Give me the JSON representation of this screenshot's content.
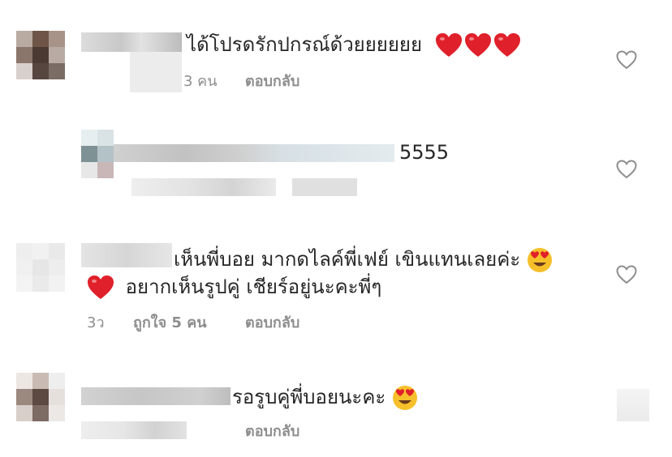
{
  "comments": [
    {
      "text": "ได้โปรดรักปกรณ์ด้วยยยยยย",
      "likes_meta": "3 คน",
      "reply_label": "ตอบกลับ",
      "trailing_emoji": [
        "red-heart",
        "red-heart",
        "red-heart"
      ]
    },
    {
      "text": "5555",
      "likes_meta": "",
      "reply_label": ""
    },
    {
      "text_line1": "เห็นพี่บอย มากดไลค์พี่เฟย์ เขินแทนเลยค่ะ",
      "text_line2": "อยากเห็นรูปคู่ เชียร์อยู่นะคะพี่ๆ",
      "time": "3ว",
      "likes_meta": "ถูกใจ 5 คน",
      "reply_label": "ตอบกลับ"
    },
    {
      "text": "รอรูบคู่พี่บอยนะคะ",
      "likes_meta": "",
      "reply_label": "ตอบกลับ"
    }
  ],
  "icons": {
    "like": "heart-outline-icon",
    "heart_emoji": "red-heart-emoji",
    "face_emoji": "heart-eyes-emoji"
  },
  "colors": {
    "text": "#262626",
    "muted": "#8e8e8e",
    "heart_red": "#e0202a",
    "emoji_yellow": "#f7c02a"
  }
}
